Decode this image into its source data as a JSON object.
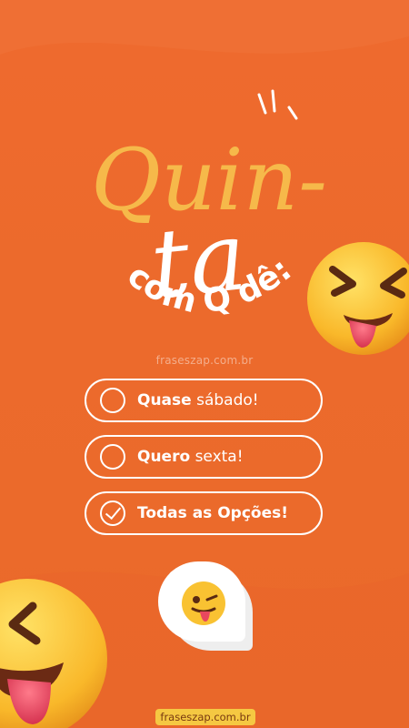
{
  "title": {
    "line1": "Quin-",
    "line2": "ta",
    "line3": "com Q dê:"
  },
  "watermark": "fraseszap.com.br",
  "options": [
    {
      "bold": "Quase",
      "rest": "sábado!",
      "checked": false
    },
    {
      "bold": "Quero",
      "rest": "sexta!",
      "checked": false
    },
    {
      "bold": "Todas as Opções!",
      "rest": "",
      "checked": true
    }
  ],
  "footer": "fraseszap.com.br",
  "colors": {
    "background": "#ec6a2c",
    "title_yellow": "#f6b94a",
    "white": "#ffffff",
    "footer_badge": "#f5c842"
  },
  "icons": [
    "squint-tongue-emoji",
    "winking-tongue-emoji",
    "check-icon"
  ]
}
